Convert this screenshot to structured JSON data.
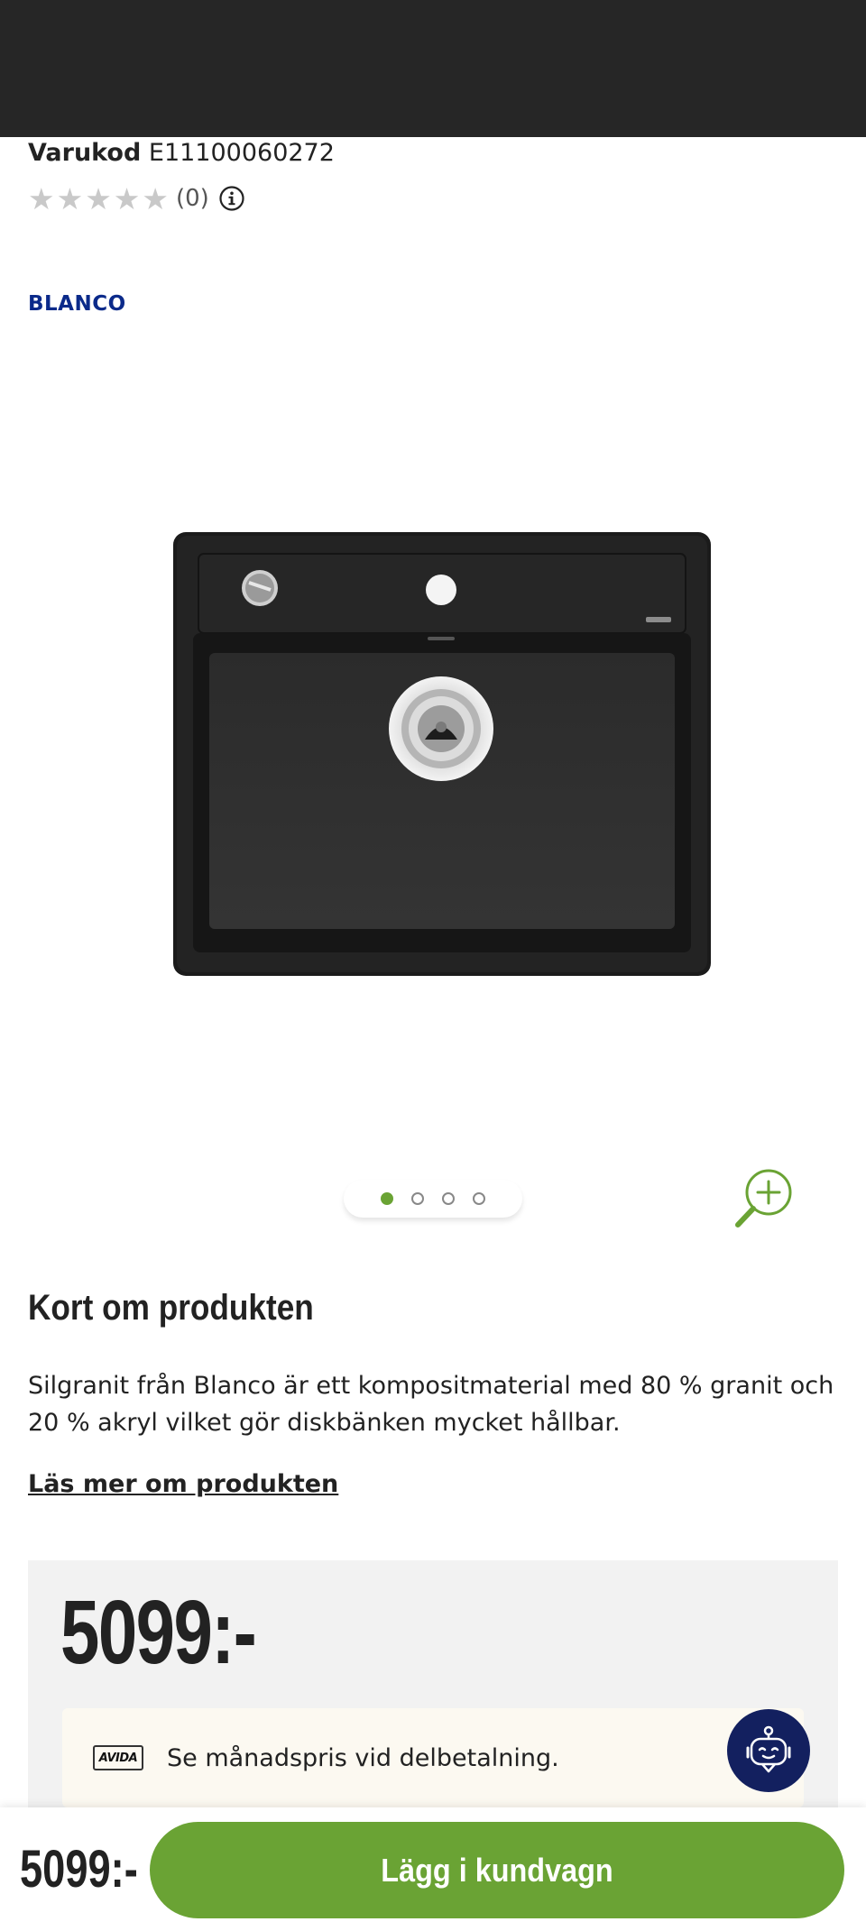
{
  "product": {
    "sku_label": "Varukod",
    "sku_value": "E11100060272",
    "rating_count": "(0)",
    "rating_value": 0,
    "rating_max": 5,
    "brand": "BLANCO"
  },
  "gallery": {
    "image_count": 4,
    "active_index": 0
  },
  "summary": {
    "heading": "Kort om produkten",
    "description": "Silgranit från Blanco är ett kompositmaterial med 80 % granit och 20 % akryl vilket gör diskbänken mycket hållbar.",
    "read_more": "Läs mer om produkten"
  },
  "price": {
    "amount": "5099:-",
    "financing_logo": "AVIDA",
    "financing_text": "Se månadspris vid delbetalning."
  },
  "bottom_bar": {
    "price": "5099:-",
    "add_to_cart": "Lägg i kundvagn"
  },
  "colors": {
    "accent_green": "#6aa334",
    "brand_blue": "#0b2a8a",
    "chat_navy": "#13205f",
    "topbar": "#262626"
  },
  "icons": [
    "star-icon",
    "info-icon",
    "zoom-in-icon",
    "chatbot-icon"
  ]
}
